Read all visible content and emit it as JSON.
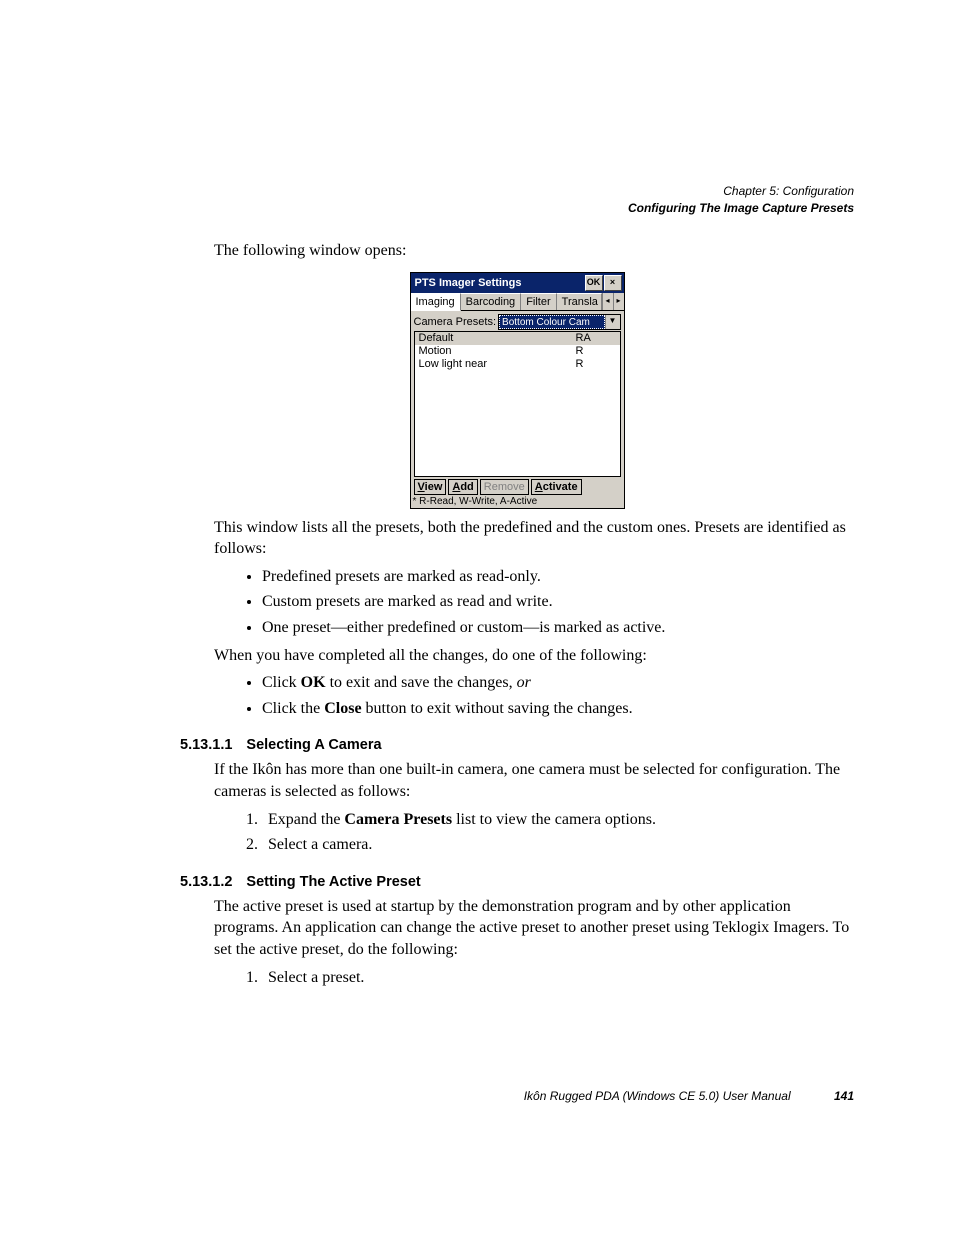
{
  "header": {
    "chapter": "Chapter 5: Configuration",
    "section": "Configuring The Image Capture Presets"
  },
  "intro": "The following window opens:",
  "window": {
    "title": "PTS Imager Settings",
    "ok": "OK",
    "close": "×",
    "tabs": [
      "Imaging",
      "Barcoding",
      "Filter",
      "Transla"
    ],
    "presets_label": "Camera Presets:",
    "dropdown_value": "Bottom Colour Cam",
    "list": [
      {
        "name": "Default",
        "flags": "RA"
      },
      {
        "name": "Motion",
        "flags": "R"
      },
      {
        "name": "Low light near",
        "flags": "R"
      }
    ],
    "buttons": {
      "view": "View",
      "add": "Add",
      "remove": "Remove",
      "activate": "Activate"
    },
    "legend": "* R-Read, W-Write, A-Active"
  },
  "para1": "This window lists all the presets, both the predefined and the custom ones. Presets are identified as follows:",
  "bullets1": [
    "Predefined presets are marked as read-only.",
    "Custom presets are marked as read and write.",
    "One preset—either predefined or custom—is marked as active."
  ],
  "para2": "When you have completed all the changes, do one of the following:",
  "bullets2_a_pre": "Click ",
  "bullets2_a_bold": "OK",
  "bullets2_a_mid": " to exit and save the changes, ",
  "bullets2_a_it": "or",
  "bullets2_b_pre": "Click the ",
  "bullets2_b_bold": "Close",
  "bullets2_b_post": " button to exit without saving the changes.",
  "sec1": {
    "num": "5.13.1.1",
    "title": "Selecting A Camera",
    "para": "If the Ikôn has more than one built-in camera, one camera must be selected for configuration. The cameras is selected as follows:",
    "step1_pre": "Expand the ",
    "step1_bold": "Camera Presets",
    "step1_post": " list to view the camera options.",
    "step2": "Select a camera."
  },
  "sec2": {
    "num": "5.13.1.2",
    "title": "Setting The Active Preset",
    "para": "The active preset is used at startup by the demonstration program and by other application programs. An application can change the active preset to another preset using Teklogix Imagers. To set the active preset, do the following:",
    "step1": "Select a preset."
  },
  "footer": {
    "text": "Ikôn Rugged PDA (Windows CE 5.0) User Manual",
    "page": "141"
  }
}
